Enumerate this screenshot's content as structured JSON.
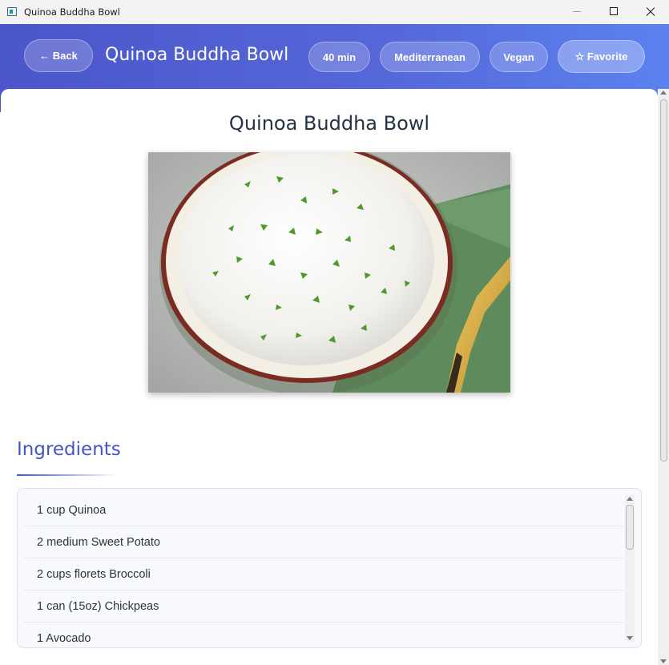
{
  "window": {
    "title": "Quinoa Buddha Bowl"
  },
  "header": {
    "back_label": "← Back",
    "title": "Quinoa Buddha Bowl",
    "tags": {
      "time": "40 min",
      "cuisine": "Mediterranean",
      "diet": "Vegan"
    },
    "favorite_label": "☆ Favorite"
  },
  "recipe": {
    "title": "Quinoa Buddha Bowl"
  },
  "ingredients": {
    "heading": "Ingredients",
    "items": [
      "1 cup Quinoa",
      "2 medium Sweet Potato",
      "2 cups florets Broccoli",
      "1 can (15oz) Chickpeas",
      "1 Avocado"
    ]
  },
  "colors": {
    "header_start": "#4b56c9",
    "header_end": "#5b82f0",
    "accent": "#4553c4",
    "title_text": "#233244"
  }
}
